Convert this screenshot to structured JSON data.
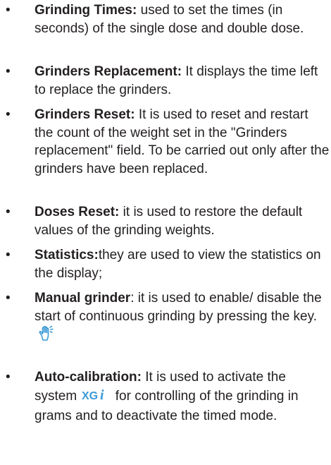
{
  "items": [
    {
      "term": "Grinding Times:",
      "text": " used to set the times (in seconds) of the single dose and double dose."
    },
    {
      "term": "Grinders Replacement:",
      "text": " It displays the time left to replace the grinders."
    },
    {
      "term": "Grinders Reset:",
      "text": " It is used to reset and restart the count of the weight set in the \"Grinders replacement\" field. To be carried out only after the grinders have been replaced."
    },
    {
      "term": "Doses Reset:",
      "text": " it is used to restore the default values of the grinding weights."
    },
    {
      "term": "Statistics:",
      "text": "they are used to view the statistics on the display;"
    },
    {
      "term": "Manual grinder",
      "text": ": it is used to enable/ disable the start of continuous grinding by pressing the key.",
      "icon": "hand-press-icon"
    },
    {
      "term": "Auto-calibration:",
      "text_before": " It is used to activate the system",
      "logo": "XGi",
      "text_after": " for controlling of the grinding in grams and to deactivate the timed mode."
    }
  ],
  "bullet_char": "•",
  "colors": {
    "text": "#231f20",
    "accent": "#3d9ad6"
  }
}
